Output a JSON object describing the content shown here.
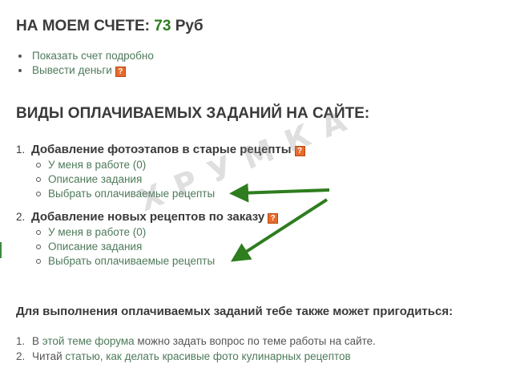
{
  "balance": {
    "label": "НА МОЕМ СЧЕТЕ:",
    "amount": "73",
    "currency": "Руб"
  },
  "account_links": [
    {
      "label": "Показать счет подробно",
      "has_help": false
    },
    {
      "label": "Вывести деньги",
      "has_help": true
    }
  ],
  "help_icon_glyph": "?",
  "tasks_heading": "ВИДЫ ОПЛАЧИВАЕМЫХ ЗАДАНИЙ НА САЙТЕ:",
  "tasks": [
    {
      "number": "1.",
      "title": "Добавление фотоэтапов в старые рецепты",
      "items": [
        "У меня в работе (0)",
        "Описание задания",
        "Выбрать оплачиваемые рецепты"
      ]
    },
    {
      "number": "2.",
      "title": "Добавление новых рецептов по заказу",
      "items": [
        "У меня в работе (0)",
        "Описание задания",
        "Выбрать оплачиваемые рецепты"
      ]
    }
  ],
  "useful": {
    "heading": "Для выполнения оплачиваемых заданий тебе также может пригодиться:",
    "items": [
      {
        "number": "1.",
        "prefix": "В ",
        "link": "этой теме форума",
        "suffix": " можно задать вопрос по теме работы на сайте."
      },
      {
        "number": "2.",
        "prefix": "Читай ",
        "link": "статью, как делать красивые фото кулинарных рецептов",
        "suffix": ""
      }
    ]
  },
  "watermark": "ХРУМКА",
  "colors": {
    "accent": "#2d7d1e",
    "link": "#4e7a5a",
    "help": "#e86a2b",
    "arrow": "#2e7d1f"
  }
}
